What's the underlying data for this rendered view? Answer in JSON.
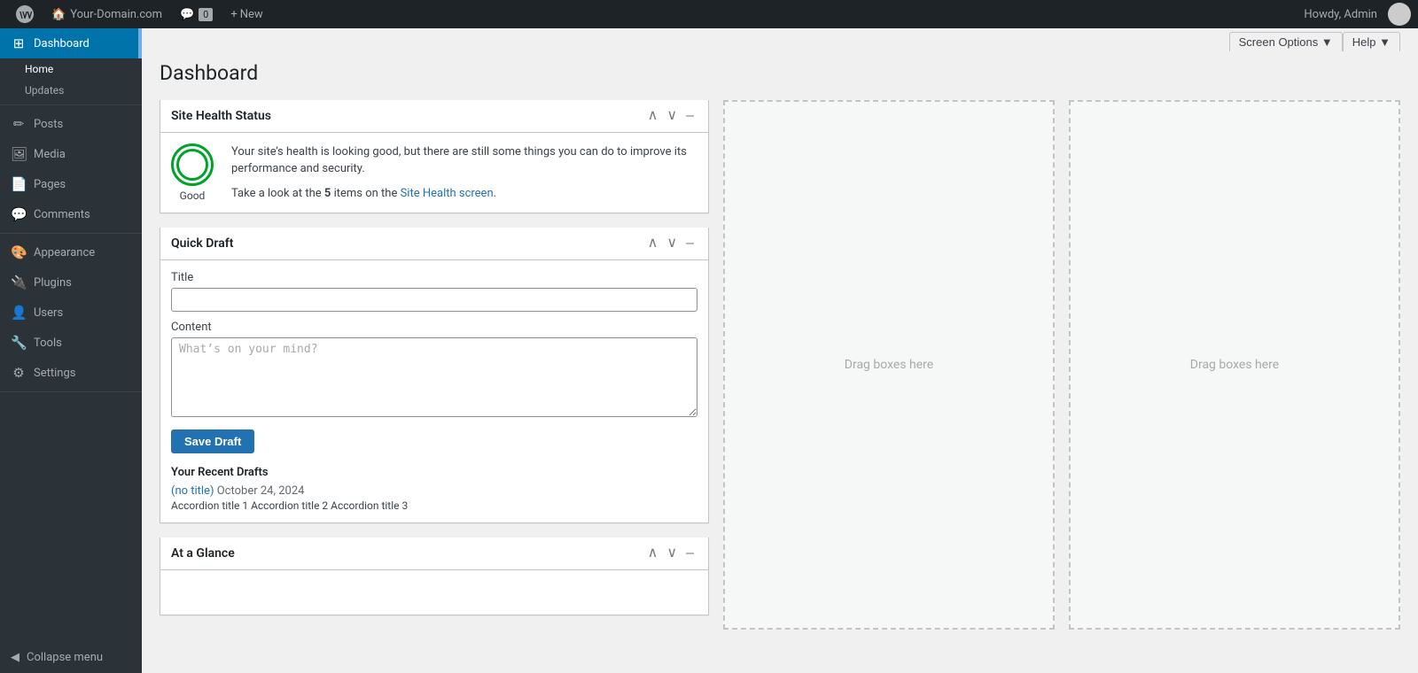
{
  "adminbar": {
    "wp_logo_title": "About WordPress",
    "site_name": "Your-Domain.com",
    "comments_count": "0",
    "new_label": "New",
    "howdy_text": "Howdy, Admin"
  },
  "sidebar": {
    "dashboard_label": "Dashboard",
    "home_label": "Home",
    "updates_label": "Updates",
    "posts_label": "Posts",
    "media_label": "Media",
    "pages_label": "Pages",
    "comments_label": "Comments",
    "appearance_label": "Appearance",
    "plugins_label": "Plugins",
    "users_label": "Users",
    "tools_label": "Tools",
    "settings_label": "Settings",
    "collapse_label": "Collapse menu"
  },
  "header": {
    "title": "Dashboard",
    "screen_options_label": "Screen Options",
    "help_label": "Help"
  },
  "site_health": {
    "title": "Site Health Status",
    "status": "Good",
    "description_1": "Your site’s health is looking good, but there are still some things you can do to improve its performance and security.",
    "description_2": "Take a look at the ",
    "items_count": "5",
    "items_label": " items",
    "items_link_text": " on the ",
    "link_text": "Site Health screen",
    "description_end": "."
  },
  "quick_draft": {
    "title": "Quick Draft",
    "title_label": "Title",
    "title_placeholder": "",
    "content_label": "Content",
    "content_placeholder": "What’s on your mind?",
    "save_button": "Save Draft",
    "recent_drafts_heading": "Your Recent Drafts",
    "draft_1_link": "(no title)",
    "draft_1_date": " October 24, 2024",
    "draft_2_text": "Accordion title 1 Accordion title 2 Accordion title 3"
  },
  "at_a_glance": {
    "title": "At a Glance"
  },
  "drag_boxes": {
    "label": "Drag boxes here"
  }
}
